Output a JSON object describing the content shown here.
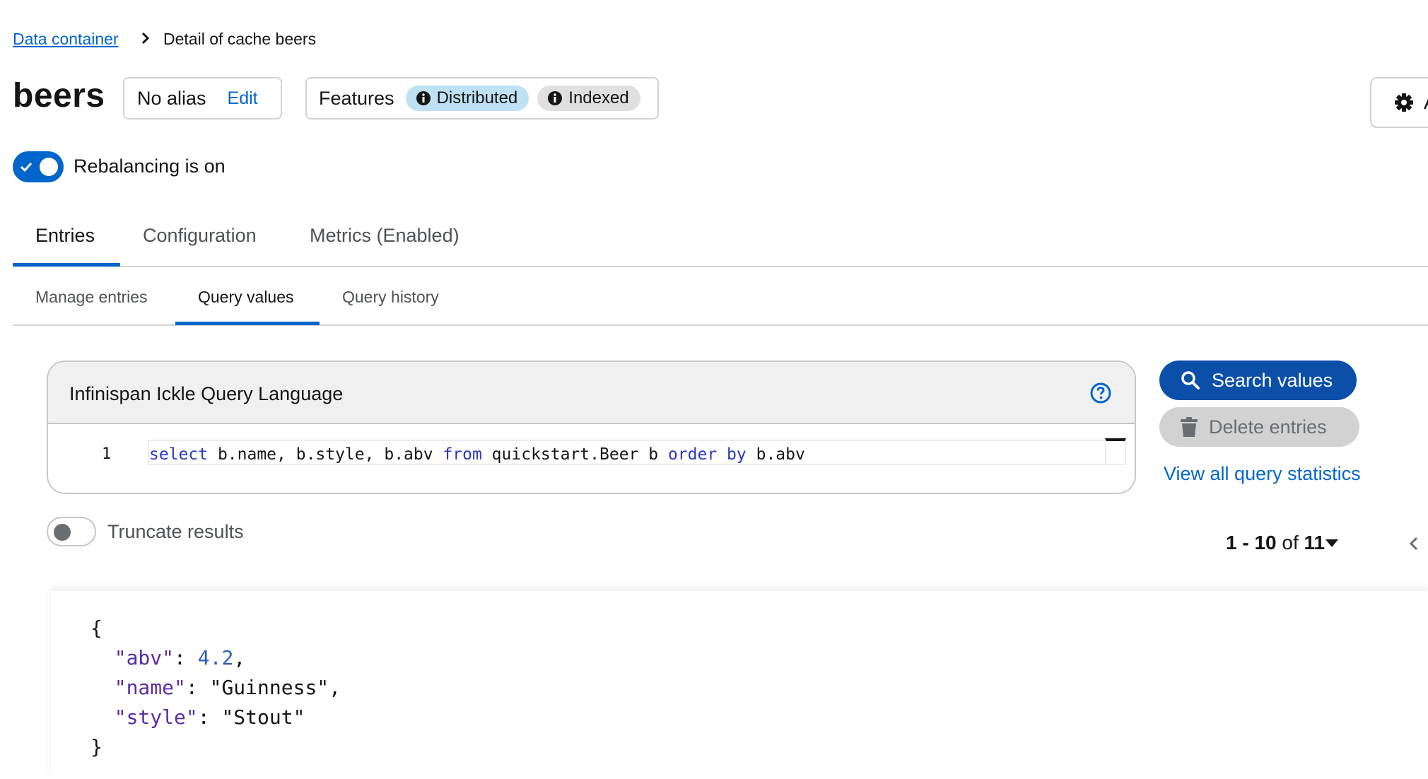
{
  "breadcrumb": {
    "parent": "Data container",
    "current": "Detail of cache beers"
  },
  "cache": {
    "name": "beers",
    "alias_text": "No alias",
    "alias_edit": "Edit",
    "features_label": "Features",
    "features": [
      "Distributed",
      "Indexed"
    ],
    "action_label": "A"
  },
  "rebalancing": {
    "label": "Rebalancing is on",
    "enabled": true
  },
  "tabs": [
    "Entries",
    "Configuration",
    "Metrics (Enabled)"
  ],
  "active_tab": "Entries",
  "subtabs": [
    "Manage entries",
    "Query values",
    "Query history"
  ],
  "active_subtab": "Query values",
  "editor": {
    "title": "Infinispan Ickle Query Language",
    "line_number": "1",
    "query_tokens": [
      {
        "t": "select",
        "kw": true
      },
      {
        "t": " b.name, b.style, b.abv ",
        "kw": false
      },
      {
        "t": "from",
        "kw": true
      },
      {
        "t": " quickstart.Beer b ",
        "kw": false
      },
      {
        "t": "order",
        "kw": true
      },
      {
        "t": " ",
        "kw": false
      },
      {
        "t": "by",
        "kw": true
      },
      {
        "t": " b.abv",
        "kw": false
      }
    ]
  },
  "buttons": {
    "search": "Search values",
    "delete": "Delete entries",
    "stats": "View all query statistics"
  },
  "truncate": {
    "label": "Truncate results",
    "enabled": false
  },
  "pagination": {
    "range": "1 - 10",
    "of_word": "of",
    "total": "11"
  },
  "result": {
    "abv": "4.2",
    "name": "\"Guinness\"",
    "style": "\"Stout\""
  },
  "colors": {
    "primary": "#0066cc",
    "search_button": "#0b4fa9",
    "chip_distributed": "#bee1f4",
    "chip_indexed": "#e0e0e0"
  },
  "icons": [
    "chevron-right-icon",
    "info-circle-icon",
    "gear-icon",
    "check-icon",
    "help-circle-icon",
    "search-icon",
    "trash-icon",
    "caret-down-icon",
    "chevron-left-icon"
  ]
}
